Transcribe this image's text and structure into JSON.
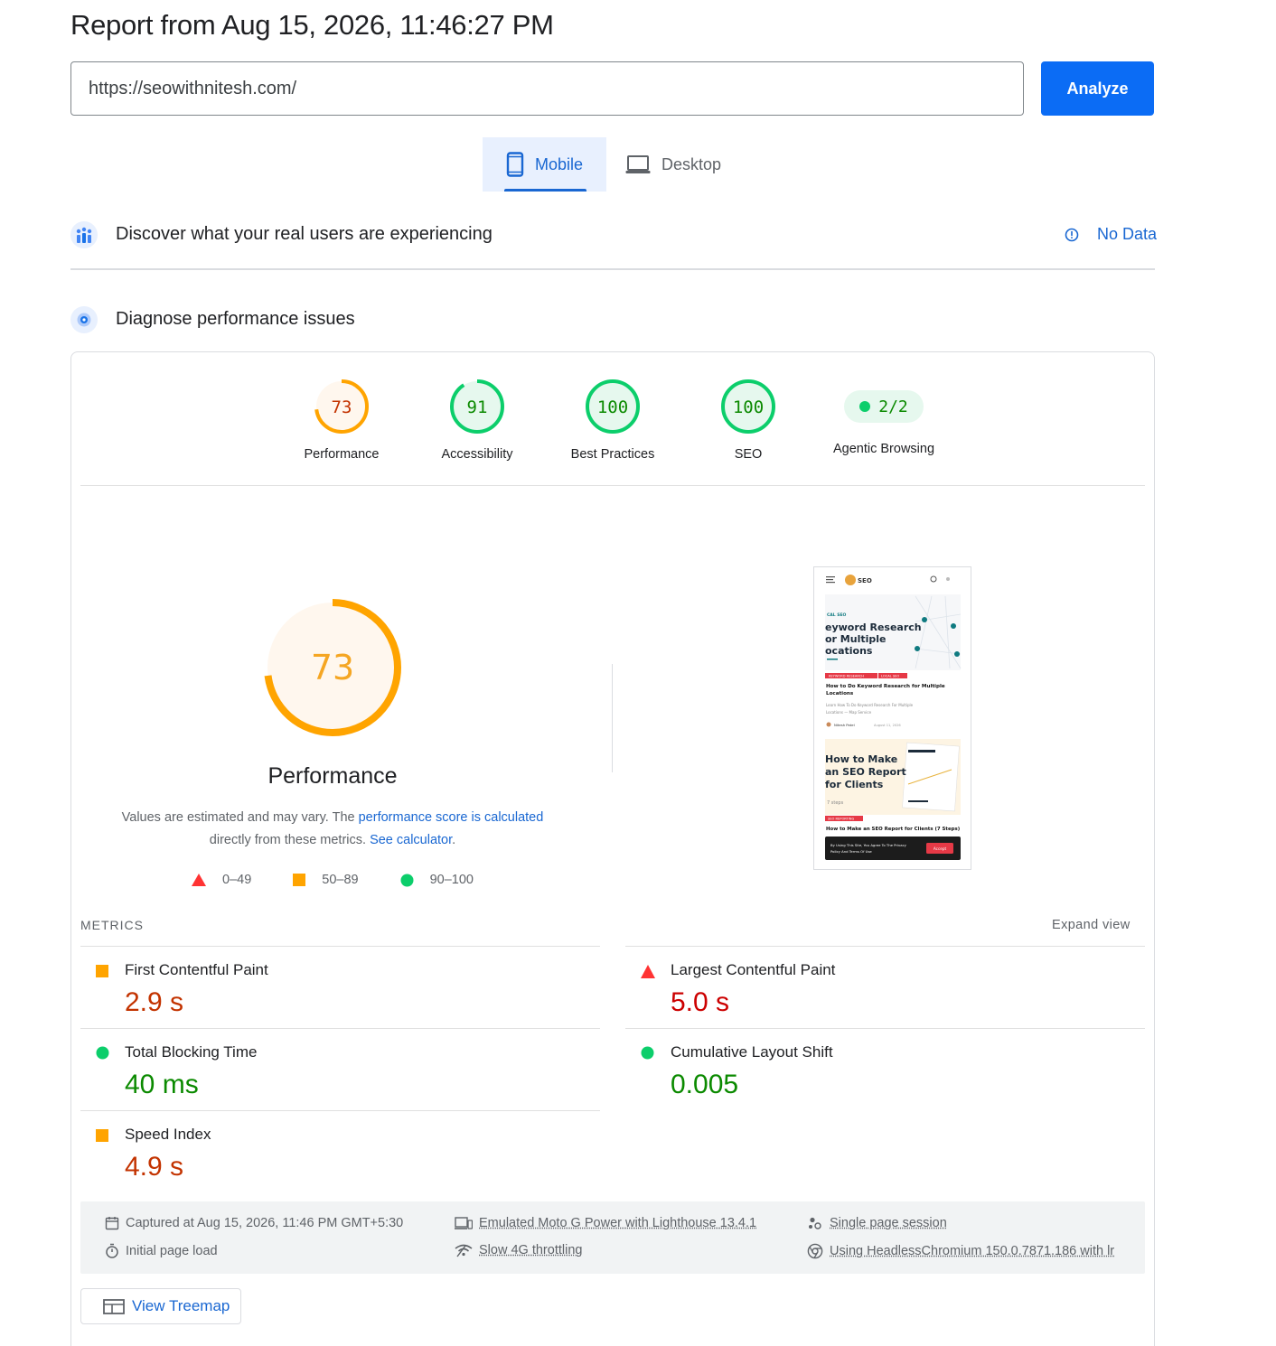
{
  "header": {
    "title": "Report from Aug 15, 2026, 11:46:27 PM"
  },
  "url_bar": {
    "value": "https://seowithnitesh.com/",
    "button_label": "Analyze"
  },
  "tabs": [
    {
      "label": "Mobile",
      "selected": true,
      "icon": "phone-icon"
    },
    {
      "label": "Desktop",
      "selected": false,
      "icon": "laptop-icon"
    }
  ],
  "field_section": {
    "title": "Discover what your real users are experiencing",
    "status": "No Data"
  },
  "lab_section": {
    "title": "Diagnose performance issues"
  },
  "categories": [
    {
      "label": "Performance",
      "score": "73",
      "color": "#ffa400",
      "text_color": "#c33300",
      "fraction": 0.73
    },
    {
      "label": "Accessibility",
      "score": "91",
      "color": "#0cce6b",
      "text_color": "#0b8a00",
      "fraction": 0.91
    },
    {
      "label": "Best Practices",
      "score": "100",
      "color": "#0cce6b",
      "text_color": "#0b8a00",
      "fraction": 1.0
    },
    {
      "label": "SEO",
      "score": "100",
      "color": "#0cce6b",
      "text_color": "#0b8a00",
      "fraction": 1.0
    },
    {
      "label": "Agentic Browsing",
      "score": "2/2",
      "color": "#0cce6b",
      "text_color": "#0b8a00"
    }
  ],
  "performance": {
    "score": "73",
    "fraction": 0.73,
    "title": "Performance",
    "desc_prefix": "Values are estimated and may vary. The ",
    "desc_link": "performance score is calculated",
    "desc_middle": "directly from these metrics. ",
    "desc_link2": "See calculator",
    "desc_suffix": "."
  },
  "legend": [
    {
      "range": "0–49",
      "color": "#ff3333",
      "shape": "triangle"
    },
    {
      "range": "50–89",
      "color": "#ffa400",
      "shape": "square"
    },
    {
      "range": "90–100",
      "color": "#0cce6b",
      "shape": "circle"
    }
  ],
  "preview": {
    "badge1": "CAL SEO",
    "hero1": "eyword Research\nor Multiple\nocations",
    "tag1a": "KEYWORD RESEARCH",
    "tag1b": "LOCAL SEO",
    "post1_title": "How to Do Keyword Research for Multiple Locations",
    "post1_desc": "Learn How To Do Keyword Research For Multiple Locations — Map Service",
    "author": "Nitesh Patel",
    "date": "August 11, 2026",
    "hero2": "How to Make\nan SEO Report\nfor Clients",
    "steps": "7 steps",
    "tag2": "SEO REPORTING",
    "post2_title": "How to Make an SEO Report for Clients (7 Steps)",
    "cookie_text": "By Using This Site, You Agree To The Privacy Policy And Terms Of Use",
    "cookie_btn": "Accept",
    "logo": "SEO"
  },
  "metrics": {
    "heading": "METRICS",
    "expand_label": "Expand view",
    "items": [
      {
        "name": "First Contentful Paint",
        "value": "2.9 s",
        "rating": "average"
      },
      {
        "name": "Largest Contentful Paint",
        "value": "5.0 s",
        "rating": "fail"
      },
      {
        "name": "Total Blocking Time",
        "value": "40 ms",
        "rating": "pass"
      },
      {
        "name": "Cumulative Layout Shift",
        "value": "0.005",
        "rating": "pass"
      },
      {
        "name": "Speed Index",
        "value": "4.9 s",
        "rating": "average"
      }
    ]
  },
  "run_info": {
    "captured": "Captured at Aug 15, 2026, 11:46 PM GMT+5:30",
    "load": "Initial page load",
    "device": "Emulated Moto G Power with Lighthouse 13.4.1",
    "throttling": "Slow 4G throttling",
    "session": "Single page session",
    "browser": "Using HeadlessChromium 150.0.7871.186 with lr"
  },
  "treemap": {
    "label": "View Treemap"
  }
}
